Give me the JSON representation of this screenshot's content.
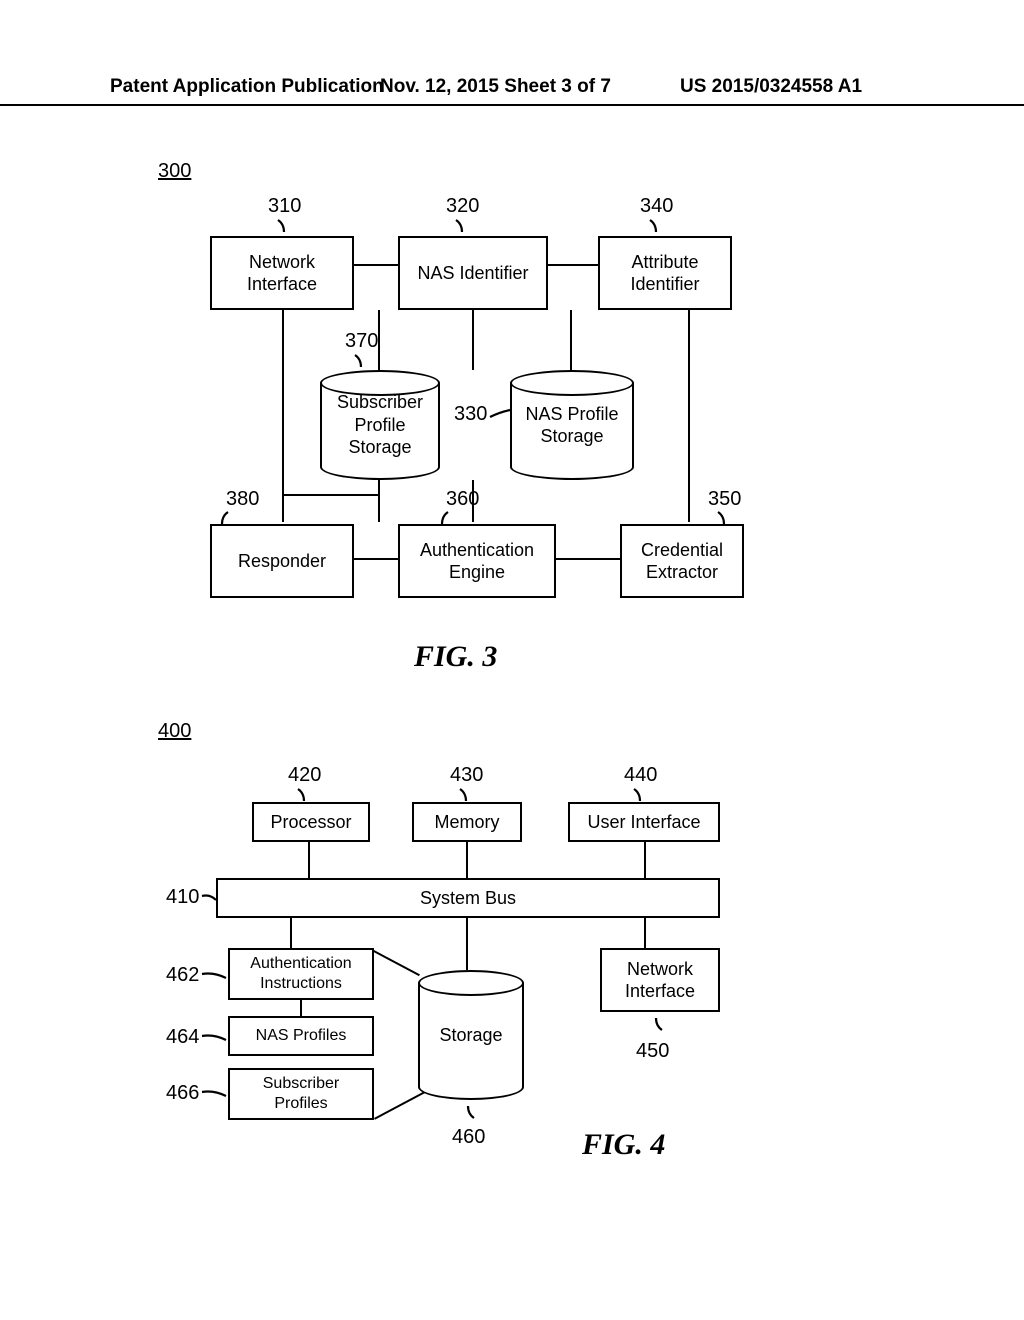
{
  "header": {
    "left": "Patent Application Publication",
    "mid": "Nov. 12, 2015  Sheet 3 of 7",
    "right": "US 2015/0324558 A1"
  },
  "fig3": {
    "number": "300",
    "caption": "FIG.   3",
    "refs": {
      "r310": "310",
      "r320": "320",
      "r340": "340",
      "r370": "370",
      "r330": "330",
      "r380": "380",
      "r360": "360",
      "r350": "350"
    },
    "blocks": {
      "network_interface": "Network\nInterface",
      "nas_identifier": "NAS Identifier",
      "attribute_identifier": "Attribute\nIdentifier",
      "subscriber_profile_storage": "Subscriber\nProfile\nStorage",
      "nas_profile_storage": "NAS Profile\nStorage",
      "responder": "Responder",
      "authentication_engine": "Authentication\nEngine",
      "credential_extractor": "Credential\nExtractor"
    }
  },
  "fig4": {
    "number": "400",
    "caption": "FIG.   4",
    "refs": {
      "r420": "420",
      "r430": "430",
      "r440": "440",
      "r410": "410",
      "r462": "462",
      "r464": "464",
      "r466": "466",
      "r460": "460",
      "r450": "450"
    },
    "blocks": {
      "processor": "Processor",
      "memory": "Memory",
      "user_interface": "User Interface",
      "system_bus": "System Bus",
      "authentication_instructions": "Authentication\nInstructions",
      "nas_profiles": "NAS Profiles",
      "subscriber_profiles": "Subscriber\nProfiles",
      "storage": "Storage",
      "network_interface": "Network\nInterface"
    }
  }
}
